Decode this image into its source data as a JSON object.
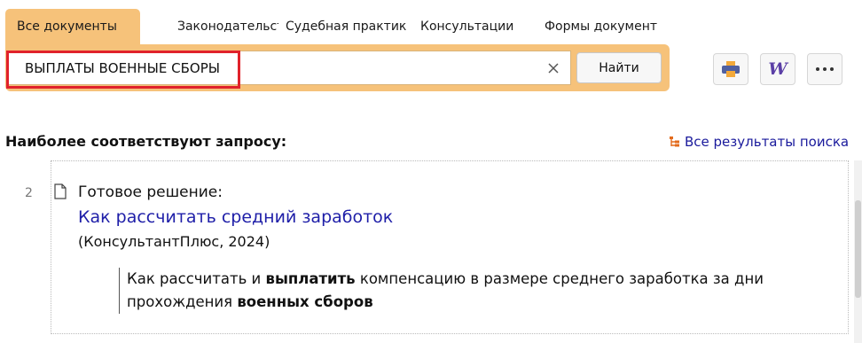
{
  "tabs": [
    {
      "label": "Все документы",
      "active": true
    },
    {
      "label": "Законодательств",
      "active": false
    },
    {
      "label": "Судебная практик",
      "active": false
    },
    {
      "label": "Консультации",
      "active": false
    },
    {
      "label": "Формы документ",
      "active": false
    }
  ],
  "search": {
    "value": "ВЫПЛАТЫ ВОЕННЫЕ СБОРЫ",
    "find_label": "Найти",
    "clear_icon": "close-icon"
  },
  "toolbar": {
    "print_icon": "printer-icon",
    "word_label": "W",
    "more_icon": "more-dots-icon"
  },
  "results": {
    "heading": "Наиболее соответствуют запросу:",
    "all_results_label": "Все результаты поиска",
    "items": [
      {
        "number": "2",
        "type_label": "Готовое решение:",
        "title": "Как рассчитать средний заработок",
        "source": "(КонсультантПлюс, 2024)",
        "snippet_parts": [
          {
            "text": "Как рассчитать и ",
            "bold": false
          },
          {
            "text": "выплатить",
            "bold": true
          },
          {
            "text": " компенсацию в размере среднего заработка за дни прохождения ",
            "bold": false
          },
          {
            "text": "военных сборов",
            "bold": true
          }
        ]
      }
    ]
  },
  "colors": {
    "accent": "#f6c27a",
    "link": "#1e1ea8",
    "highlight": "#e0222b",
    "word_icon": "#5b3fa6",
    "print_icon_body": "#5060a0",
    "print_icon_paper": "#f2a93b"
  }
}
